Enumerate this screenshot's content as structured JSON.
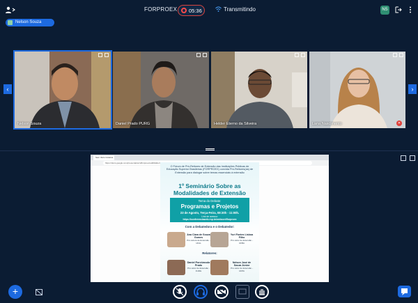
{
  "topbar": {
    "meeting_title": "FORPROEX",
    "recording_time": "05:36",
    "broadcast_label": "Transmitindo",
    "user_initials": "NS"
  },
  "presenter": {
    "name": "Nelson Souza"
  },
  "webcams": [
    {
      "name": "Nelson Souza",
      "active": true
    },
    {
      "name": "Daniel Prado PURG",
      "active": false
    },
    {
      "name": "Helder Eterno da Silveira",
      "active": false
    },
    {
      "name": "Lana Nascimento",
      "active": false
    }
  ],
  "browser": {
    "tab_title": "Sem título Coletiva",
    "url": "https://docs.google.com/presentation/d/forproex/edit#slide=id.p"
  },
  "flyer": {
    "intro": "O Fórum de Pró-Reitores de Extensão das Instituições Públicas de Educação Superior Brasileiras (FORPROEX) convida Pró-Reitores(as) de Extensão para dialogar sobre temas essenciais à extensão",
    "heading_line1": "1º Seminário Sobre as",
    "heading_line2": "Modalidades de Extensão",
    "debate_label": "Tema do Debate:",
    "debate_topic": "Programas e Projetos",
    "debate_date": "23 de Agosto, Terça-Feira, 08:30h - 11:00h.",
    "link_label": "Link de acesso:",
    "link": "https://conferenciaweb.rnp.br/webconf/forproex",
    "moderators_title": "Com a Debatedora e o Debatedor:",
    "moderators": [
      {
        "name": "Ana Clara de Souza Gomes",
        "role": "Pró-reitora de Extensão - UFAL"
      },
      {
        "name": "Yuri Fontes Lisboa Filho",
        "role": "Pró-reitor de Extensão - UFBA"
      }
    ],
    "rapporteurs_title": "Relatores:",
    "rapporteurs": [
      {
        "name": "Daniel Porciúncula Prado",
        "role": "Pró-reitor de Extensão - FURG"
      },
      {
        "name": "Nelson José de Souza Júnior",
        "role": "Pró-reitor de Extensão - UFPA"
      }
    ]
  },
  "colors": {
    "background": "#0b1c33",
    "accent": "#1d6ae0",
    "record": "#ff4a4a",
    "flyer_teal": "#10a0a6"
  }
}
